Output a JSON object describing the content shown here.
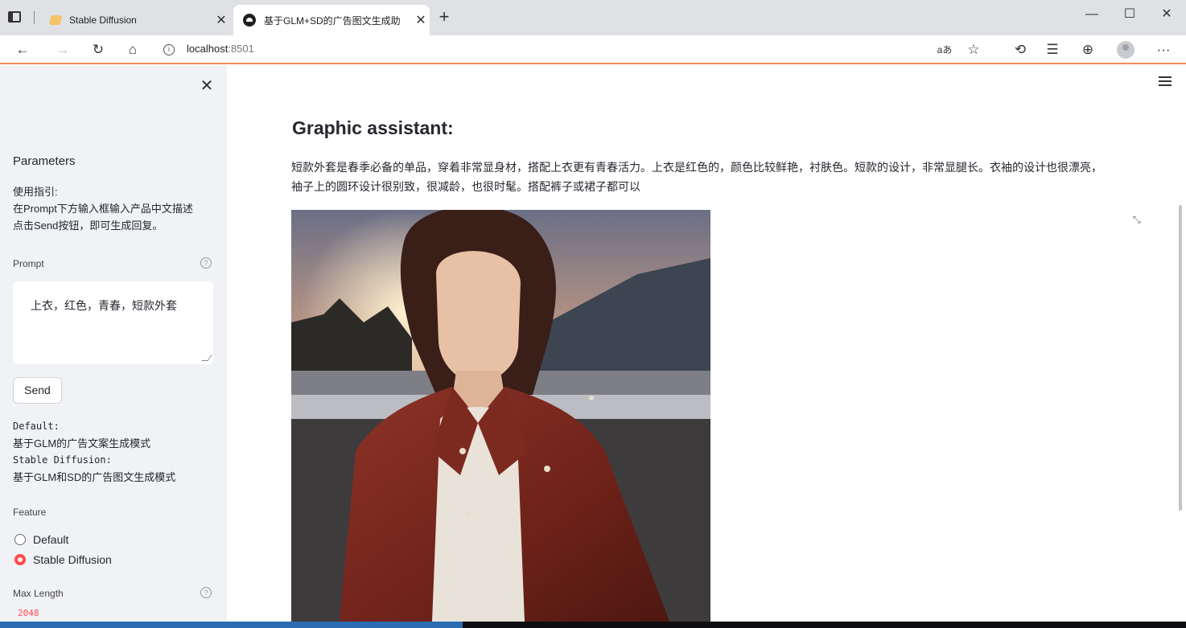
{
  "browser": {
    "tabs": [
      {
        "title": "Stable Diffusion",
        "active": false
      },
      {
        "title": "基于GLM+SD的广告图文生成助",
        "active": true
      }
    ],
    "address": {
      "host": "localhost",
      "port": ":8501"
    }
  },
  "sidebar": {
    "heading": "Parameters",
    "guide_title": "使用指引:",
    "guide_line1": "在Prompt下方输入框输入产品中文描述",
    "guide_line2": "点击Send按钮，即可生成回复。",
    "prompt_label": "Prompt",
    "prompt_value": "上衣，红色，青春，短款外套",
    "send_label": "Send",
    "default_key": "Default:",
    "default_desc": "基于GLM的广告文案生成模式",
    "sd_key": "Stable Diffusion:",
    "sd_desc": "基于GLM和SD的广告图文生成模式",
    "feature_label": "Feature",
    "feature_options": [
      "Default",
      "Stable Diffusion"
    ],
    "feature_selected": "Stable Diffusion",
    "max_length_label": "Max Length",
    "max_length_value": "2048"
  },
  "main": {
    "title": "Graphic assistant:",
    "description": "短款外套是春季必备的单品，穿着非常显身材，搭配上衣更有青春活力。上衣是红色的，颜色比较鲜艳，衬肤色。短款的设计，非常显腿长。衣袖的设计也很漂亮，袖子上的圆环设计很别致，很减龄，也很时髦。搭配裤子或裙子都可以"
  },
  "colors": {
    "accent": "#ff4b4b",
    "sidebar_bg": "#f0f2f6",
    "toolbar_border": "#f08a54"
  },
  "icons": [
    "tab-actions-icon",
    "back-icon",
    "forward-icon",
    "refresh-icon",
    "home-icon",
    "info-icon",
    "read-aloud-icon",
    "favorite-icon",
    "extensions-icon",
    "favorites-icon",
    "collections-icon",
    "profile-icon",
    "more-icon",
    "close-icon",
    "help-icon",
    "hamburger-icon",
    "fullscreen-icon"
  ]
}
